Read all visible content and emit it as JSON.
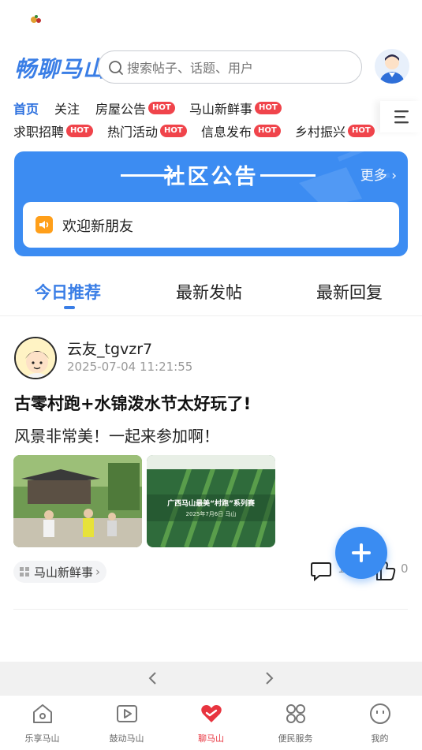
{
  "header": {
    "brand": "畅聊马山",
    "search_placeholder": "搜索帖子、话题、用户"
  },
  "categories": {
    "row1": [
      {
        "label": "首页",
        "hot": false,
        "active": true
      },
      {
        "label": "关注",
        "hot": false
      },
      {
        "label": "房屋公告",
        "hot": true
      },
      {
        "label": "马山新鲜事",
        "hot": true
      }
    ],
    "row2": [
      {
        "label": "求职招聘",
        "hot": true
      },
      {
        "label": "热门活动",
        "hot": true
      },
      {
        "label": "信息发布",
        "hot": true
      },
      {
        "label": "乡村振兴",
        "hot": true
      }
    ],
    "hot_badge": "HOT"
  },
  "notice": {
    "title": "社区公告",
    "more": "更多",
    "message": "欢迎新朋友"
  },
  "tabs": [
    "今日推荐",
    "最新发帖",
    "最新回复"
  ],
  "post": {
    "username": "云友_tgvzr7",
    "time": "2025-07-04 11:21:55",
    "title": "古零村跑+水锦泼水节太好玩了!",
    "body": "风景非常美！一起来参加啊！",
    "tag": "马山新鲜事",
    "comments": "1",
    "likes": "0",
    "image2_caption": "广西马山最美“村跑”系列赛",
    "image2_subcaption": "2025年7月6日 马山"
  },
  "bottom_tabs": [
    {
      "label": "乐享马山",
      "icon": "home-icon"
    },
    {
      "label": "鼓动马山",
      "icon": "play-icon"
    },
    {
      "label": "聊马山",
      "icon": "heart-chat-icon",
      "active": true
    },
    {
      "label": "便民服务",
      "icon": "grid-icon"
    },
    {
      "label": "我的",
      "icon": "smile-icon"
    }
  ],
  "colors": {
    "accent": "#3a7ee6",
    "hot": "#f0444b",
    "active_tab": "#e8343f",
    "notice_bg": "#3c8cf2"
  }
}
